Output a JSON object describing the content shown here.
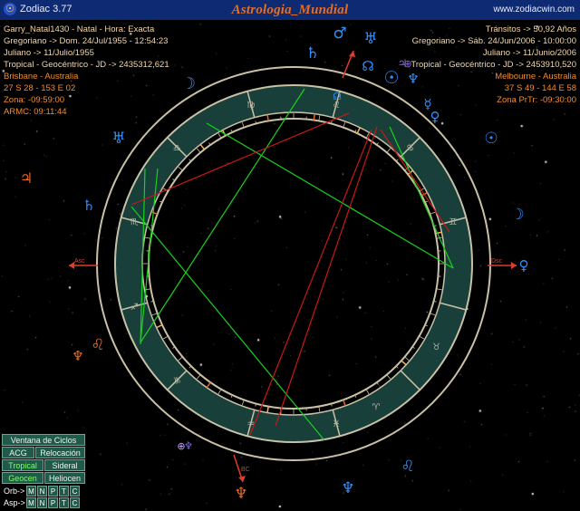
{
  "titlebar": {
    "app_name": "Zodiac 3.77",
    "brand": "Astrologia_Mundial",
    "url": "www.zodiacwin.com"
  },
  "natal": {
    "name": "Garry_Natal1430 - Natal - Hora: Exacta",
    "gregorian": "Gregoriano -> Dom. 24/Jul/1955 - 12:54:23",
    "julian": "Juliano -> 11/Julio/1955",
    "tropical": "Tropical - Geocéntrico - JD -> 2435312,621",
    "place": "Brisbane - Australia",
    "coords": "27 S 28 - 153 E 02",
    "zone": "Zona: -09:59:00",
    "armc": "ARMC: 09:11:44"
  },
  "transits": {
    "title": "Tránsitos -> 50,92 Años",
    "gregorian": "Gregoriano -> Sáb. 24/Jun/2006 - 10:00:00",
    "julian": "Juliano -> 11/Junio/2006",
    "tropical": "Tropical - Geocéntrico - JD -> 2453910,520",
    "place": "Melbourne - Australia",
    "coords": "37 S 49 - 144 E 58",
    "zone": "Zona PrTr: -09:30:00"
  },
  "angles": {
    "asc": "Asc",
    "dsc": "Dsc",
    "bc": "BC"
  },
  "colors": {
    "accent": "#e46e24",
    "ring": "#c9c1a6",
    "band": "#183f3a",
    "aspect_green": "#17d21c",
    "aspect_red": "#c81818",
    "transit_blue": "#2e8fff",
    "natal_orange": "#e86a1c"
  },
  "signs": [
    {
      "name": "aries",
      "glyph": "♈"
    },
    {
      "name": "taurus",
      "glyph": "♉"
    },
    {
      "name": "gemini",
      "glyph": "♊"
    },
    {
      "name": "cancer",
      "glyph": "♋"
    },
    {
      "name": "leo",
      "glyph": "♌"
    },
    {
      "name": "virgo",
      "glyph": "♍"
    },
    {
      "name": "libra",
      "glyph": "♎"
    },
    {
      "name": "scorpio",
      "glyph": "♏"
    },
    {
      "name": "sagittarius",
      "glyph": "♐"
    },
    {
      "name": "capricorn",
      "glyph": "♑"
    },
    {
      "name": "aquarius",
      "glyph": "♒"
    },
    {
      "name": "pisces",
      "glyph": "♓"
    }
  ],
  "transit_planets": [
    {
      "name": "mars-transit",
      "glyph": "♂"
    },
    {
      "name": "uranus-transit",
      "glyph": "♅"
    },
    {
      "name": "saturn-transit",
      "glyph": "♄"
    },
    {
      "name": "node-transit",
      "glyph": "☊"
    },
    {
      "name": "sun-moon-transit",
      "glyph": "☉"
    },
    {
      "name": "neptune-transit",
      "glyph": "♆"
    },
    {
      "name": "mercury-transit",
      "glyph": "☿"
    },
    {
      "name": "venus-transit",
      "glyph": "♀"
    },
    {
      "name": "sun-transit",
      "glyph": "☉"
    },
    {
      "name": "moon-transit",
      "glyph": "☽"
    },
    {
      "name": "venus-dsc-transit",
      "glyph": "♀"
    },
    {
      "name": "jupiter-transit",
      "glyph": "♃"
    },
    {
      "name": "neptune-transit-2",
      "glyph": "♆"
    },
    {
      "name": "pof-transit",
      "glyph": "⊕"
    },
    {
      "name": "pluto-bc-transit",
      "glyph": "♆"
    },
    {
      "name": "leo-marker",
      "glyph": "♌"
    }
  ],
  "natal_planets": [
    {
      "name": "jupiter-natal",
      "glyph": "♃"
    },
    {
      "name": "moon-natal",
      "glyph": "☽"
    },
    {
      "name": "uranus-natal",
      "glyph": "♅"
    },
    {
      "name": "saturn-natal",
      "glyph": "♄"
    },
    {
      "name": "leo-natal",
      "glyph": "♌"
    },
    {
      "name": "pluto-natal",
      "glyph": "♆"
    },
    {
      "name": "pof-natal",
      "glyph": "⊕"
    },
    {
      "name": "pluto-bc-natal",
      "glyph": "♆"
    },
    {
      "name": "node-natal",
      "glyph": "☊"
    }
  ],
  "panel": {
    "ciclos": "Ventana de Ciclos",
    "acg": "ACG",
    "relocacion": "Relocación",
    "tropical": "Tropical",
    "sideral": "Sideral",
    "geocen": "Geocen",
    "heliocen": "Heliocen",
    "orb_label": "Orb->",
    "asp_label": "Asp->",
    "toggles": [
      "M",
      "N",
      "P",
      "T",
      "C"
    ]
  }
}
